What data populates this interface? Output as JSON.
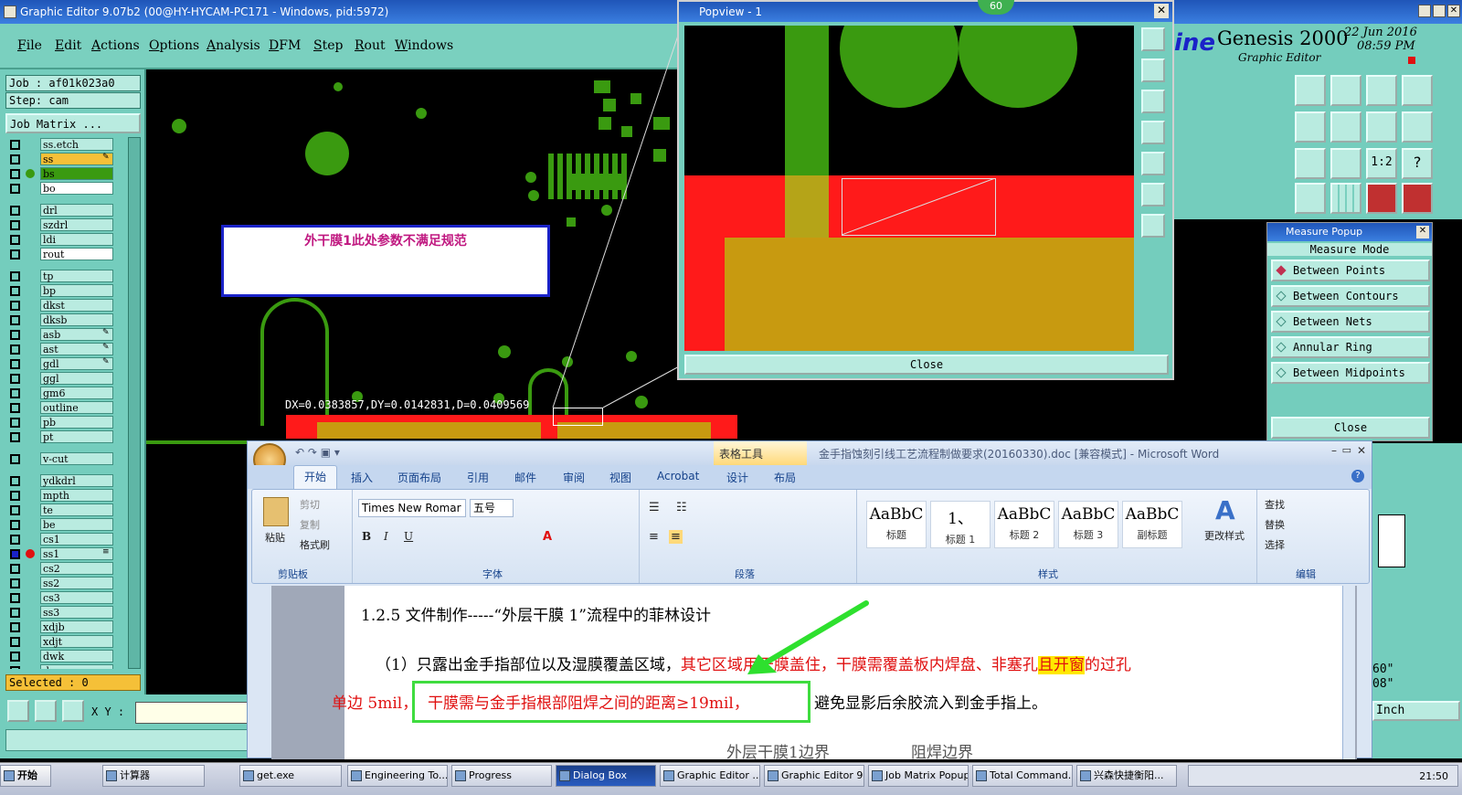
{
  "genesis": {
    "title": "Graphic Editor 9.07b2 (00@HY-HYCAM-PC171 - Windows, pid:5972)",
    "menu": [
      "File",
      "Edit",
      "Actions",
      "Options",
      "Analysis",
      "DFM",
      "Step",
      "Rout",
      "Windows"
    ],
    "job": "Job : af01k023a0",
    "step": "Step: cam",
    "job_matrix": "Job Matrix ...",
    "layers": [
      {
        "name": "ss.etch",
        "color": "#b9ebe0",
        "mark": ""
      },
      {
        "name": "ss",
        "color": "#f5c038",
        "mark": "✎"
      },
      {
        "name": "bs",
        "color": "#3a9a10",
        "mark": ""
      },
      {
        "name": "bo",
        "color": "#ffffff",
        "mark": ""
      },
      {
        "name": "drl",
        "color": "#b9ebe0",
        "mark": ""
      },
      {
        "name": "szdrl",
        "color": "#b9ebe0",
        "mark": ""
      },
      {
        "name": "ldi",
        "color": "#b9ebe0",
        "mark": ""
      },
      {
        "name": "rout",
        "color": "#ffffff",
        "mark": ""
      },
      {
        "name": "tp",
        "color": "#b9ebe0",
        "mark": ""
      },
      {
        "name": "bp",
        "color": "#b9ebe0",
        "mark": ""
      },
      {
        "name": "dkst",
        "color": "#b9ebe0",
        "mark": ""
      },
      {
        "name": "dksb",
        "color": "#b9ebe0",
        "mark": ""
      },
      {
        "name": "asb",
        "color": "#b9ebe0",
        "mark": "✎"
      },
      {
        "name": "ast",
        "color": "#b9ebe0",
        "mark": "✎"
      },
      {
        "name": "gdl",
        "color": "#b9ebe0",
        "mark": "✎"
      },
      {
        "name": "ggl",
        "color": "#b9ebe0",
        "mark": ""
      },
      {
        "name": "gm6",
        "color": "#b9ebe0",
        "mark": ""
      },
      {
        "name": "outline",
        "color": "#b9ebe0",
        "mark": ""
      },
      {
        "name": "pb",
        "color": "#b9ebe0",
        "mark": ""
      },
      {
        "name": "pt",
        "color": "#b9ebe0",
        "mark": ""
      },
      {
        "name": "v-cut",
        "color": "#b9ebe0",
        "mark": ""
      },
      {
        "name": "ydkdrl",
        "color": "#b9ebe0",
        "mark": ""
      },
      {
        "name": "mpth",
        "color": "#b9ebe0",
        "mark": ""
      },
      {
        "name": "te",
        "color": "#b9ebe0",
        "mark": ""
      },
      {
        "name": "be",
        "color": "#b9ebe0",
        "mark": ""
      },
      {
        "name": "cs1",
        "color": "#b9ebe0",
        "mark": ""
      },
      {
        "name": "ss1",
        "color": "#b9ebe0",
        "mark": "≡"
      },
      {
        "name": "cs2",
        "color": "#b9ebe0",
        "mark": ""
      },
      {
        "name": "ss2",
        "color": "#b9ebe0",
        "mark": ""
      },
      {
        "name": "cs3",
        "color": "#b9ebe0",
        "mark": ""
      },
      {
        "name": "ss3",
        "color": "#b9ebe0",
        "mark": ""
      },
      {
        "name": "xdjb",
        "color": "#b9ebe0",
        "mark": ""
      },
      {
        "name": "xdjt",
        "color": "#b9ebe0",
        "mark": ""
      },
      {
        "name": "dwk",
        "color": "#b9ebe0",
        "mark": ""
      },
      {
        "name": "d",
        "color": "#b9ebe0",
        "mark": ""
      }
    ],
    "selected": "Selected : 0",
    "xy_label": "X Y :",
    "note": "外干膜1此处参数不满足规范",
    "measure_readout": "DX=0.0383857,DY=0.0142831,D=0.0409569"
  },
  "popview": {
    "title": "Popview - 1",
    "badge": "60",
    "close": "Close"
  },
  "right_panel": {
    "logo_text": "ine",
    "app_name": "Genesis 2000",
    "subtitle": "Graphic Editor",
    "date": "22 Jun 2016",
    "time": "08:59 PM",
    "tool_label_12": "1:2",
    "tool_label_q": "?"
  },
  "measure_popup": {
    "title": "Measure Popup",
    "mode": "Measure Mode",
    "items": [
      "Between Points",
      "Between Contours",
      "Between Nets",
      "Annular Ring",
      "Between Midpoints"
    ],
    "close": "Close",
    "unit": "Inch",
    "side1": "60\"",
    "side2": "08\""
  },
  "word": {
    "title": "金手指蚀刻引线工艺流程制做要求(20160330).doc [兼容模式] - Microsoft Word",
    "table_tools": "表格工具",
    "tabs": [
      "开始",
      "插入",
      "页面布局",
      "引用",
      "邮件",
      "审阅",
      "视图",
      "Acrobat",
      "设计",
      "布局"
    ],
    "clipboard": {
      "paste": "粘贴",
      "cut": "剪切",
      "copy": "复制",
      "format": "格式刷",
      "label": "剪贴板"
    },
    "font": {
      "name": "Times New Romar",
      "size": "五号",
      "label": "字体"
    },
    "paragraph_label": "段落",
    "styles": [
      {
        "sample": "AaBbC",
        "name": "标题"
      },
      {
        "sample": "1、",
        "name": "标题 1"
      },
      {
        "sample": "AaBbC",
        "name": "标题 2"
      },
      {
        "sample": "AaBbC",
        "name": "标题 3"
      },
      {
        "sample": "AaBbC",
        "name": "副标题"
      }
    ],
    "styles_label": "样式",
    "change_styles": "更改样式",
    "editing": {
      "find": "查找",
      "replace": "替换",
      "select": "选择",
      "label": "编辑"
    },
    "doc": {
      "heading": "1.2.5 文件制作-----“外层干膜 1”流程中的菲林设计",
      "para_prefix": "（1）只露出金手指部位以及湿膜覆盖区域，",
      "para_red": "其它区域用干膜盖住，干膜需覆盖板内焊盘、非塞孔",
      "para_highlight": "且开窗",
      "para_red2": "的过孔",
      "line2_red": "单边 5mil，",
      "line2_boxed": "干膜需与金手指根部阻焊之间的距离≥19mil，",
      "line2_tail": "避免显影后余胶流入到金手指上。",
      "bottom_label1": "外层干膜1边界",
      "bottom_label2": "阻焊边界"
    }
  },
  "taskbar": {
    "start": "开始",
    "tasks": [
      "计算器",
      "get.exe",
      "Engineering To...",
      "Progress",
      "Dialog Box",
      "Graphic Editor ...",
      "Graphic Editor 9...",
      "Job Matrix Popup",
      "Total Command...",
      "兴森快捷衡阳..."
    ],
    "clock": "21:50"
  }
}
